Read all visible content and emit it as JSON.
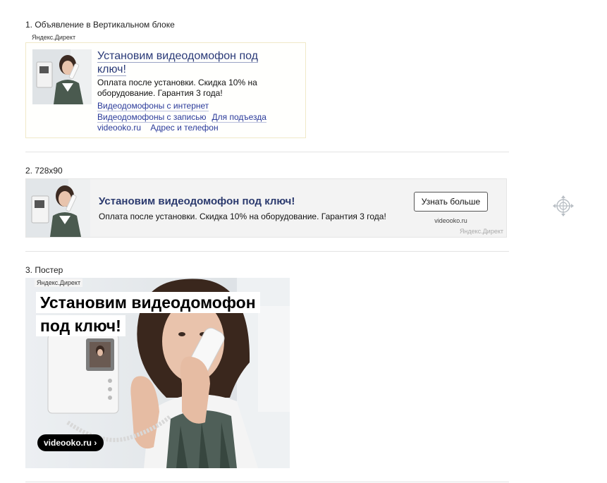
{
  "section1": {
    "title": "1. Объявление в Вертикальном блоке",
    "label": "Яндекс.Директ",
    "ad": {
      "title": "Установим видеодомофон под ключ!",
      "body": "Оплата после установки. Скидка 10% на оборудование. Гарантия 3 года!",
      "links": [
        "Видеодомофоны с интернет",
        "Видеодомофоны с записью",
        "Для подъезда"
      ],
      "domain": "videooko.ru",
      "contact": "Адрес и телефон"
    }
  },
  "section2": {
    "title": "2. 728x90",
    "ad": {
      "title": "Установим видеодомофон под ключ!",
      "body": "Оплата после установки. Скидка 10% на оборудование. Гарантия 3 года!",
      "button": "Узнать больше",
      "domain": "videooko.ru",
      "label": "Яндекс.Директ"
    }
  },
  "section3": {
    "title": "3. Постер",
    "ad": {
      "label": "Яндекс.Директ",
      "headline_line1": "Установим видеодомофон",
      "headline_line2": "под ключ!",
      "domain_chip": "videooko.ru ›"
    }
  },
  "icons": {
    "move": "move-icon"
  }
}
